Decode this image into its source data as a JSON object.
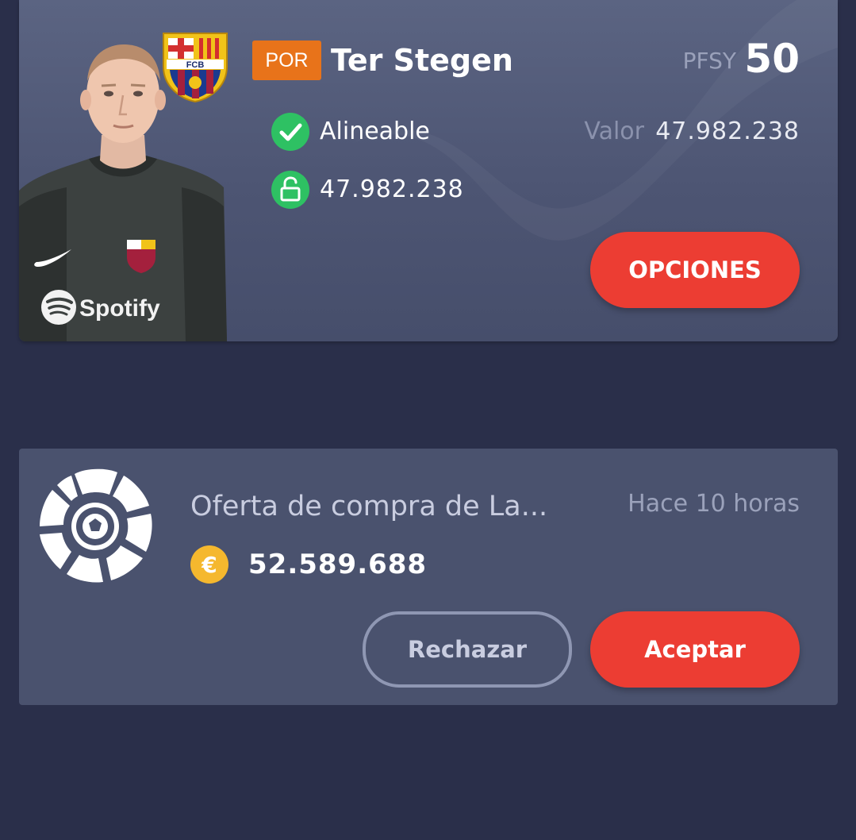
{
  "player": {
    "position": "POR",
    "name": "Ter Stegen",
    "score_label": "PFSY",
    "score_value": "50",
    "status": "Alineable",
    "value_label": "Valor",
    "value_amount": "47.982.238",
    "clause_amount": "47.982.238",
    "options_label": "OPCIONES",
    "club": {
      "badge_text": "FCB"
    },
    "shirt_sponsor": "Spotify"
  },
  "offer": {
    "title": "Oferta de compra de La...",
    "time": "Hace 10 horas",
    "amount": "52.589.688",
    "currency_symbol": "€",
    "reject_label": "Rechazar",
    "accept_label": "Aceptar"
  },
  "icons": {
    "status": "check-circle-icon",
    "clause": "unlock-icon",
    "currency": "euro-coin-icon",
    "league": "laliga-logo-icon",
    "club": "fcb-crest-icon"
  },
  "colors": {
    "background": "#2a2f4a",
    "card": "#4a526e",
    "accent_red": "#ec3d33",
    "position_orange": "#e8731a",
    "check_green": "#2ec163",
    "coin_gold": "#f5b82e"
  }
}
